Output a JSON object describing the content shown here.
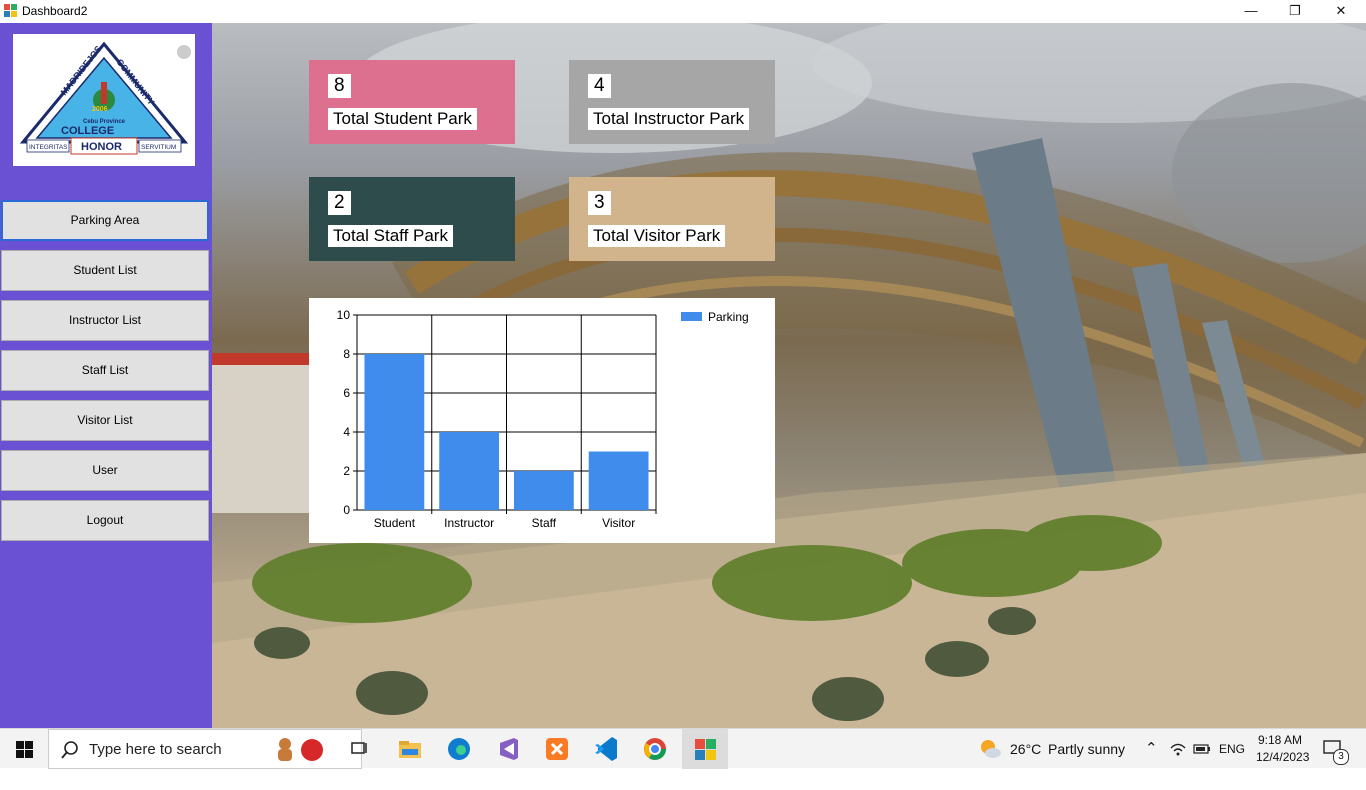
{
  "window": {
    "title": "Dashboard2",
    "minimize": "—",
    "restore": "❐",
    "close": "✕"
  },
  "logo": {
    "arc_left": "MADRIDEJOS",
    "arc_right": "COMMUNITY",
    "college": "COLLEGE",
    "province": "Cebu Province",
    "year": "2006",
    "left_motto": "INTEGRITAS",
    "center_motto": "HONOR",
    "right_motto": "SERVITIUM"
  },
  "sidebar": {
    "items": [
      {
        "label": "Parking Area"
      },
      {
        "label": "Student List"
      },
      {
        "label": "Instructor List"
      },
      {
        "label": "Staff List"
      },
      {
        "label": "Visitor List"
      },
      {
        "label": "User"
      },
      {
        "label": "Logout"
      }
    ]
  },
  "cards": [
    {
      "value": "8",
      "label": "Total Student Park",
      "color": "#dc708e"
    },
    {
      "value": "4",
      "label": "Total Instructor Park",
      "color": "#a7a6a6"
    },
    {
      "value": "2",
      "label": "Total Staff Park",
      "color": "#2e4c4c"
    },
    {
      "value": "3",
      "label": "Total Visitor Park",
      "color": "#d2b48c"
    }
  ],
  "chart_data": {
    "type": "bar",
    "categories": [
      "Student",
      "Instructor",
      "Staff",
      "Visitor"
    ],
    "series": [
      {
        "name": "Parking",
        "values": [
          8,
          4,
          2,
          3
        ],
        "color": "#3f8ced"
      }
    ],
    "yticks": [
      "0",
      "2",
      "4",
      "6",
      "8",
      "10"
    ],
    "ylim": [
      0,
      10
    ],
    "grid": true,
    "legend": "top-right"
  },
  "taskbar": {
    "search_placeholder": "Type here to search",
    "weather_temp": "26°C",
    "weather_desc": "Partly sunny",
    "language": "ENG",
    "time": "9:18 AM",
    "date": "12/4/2023",
    "notification_count": "3",
    "apps": [
      "task-view-icon",
      "file-explorer-icon",
      "edge-icon",
      "visual-studio-icon",
      "xampp-icon",
      "vscode-icon",
      "chrome-icon",
      "winforms-app-icon"
    ]
  }
}
